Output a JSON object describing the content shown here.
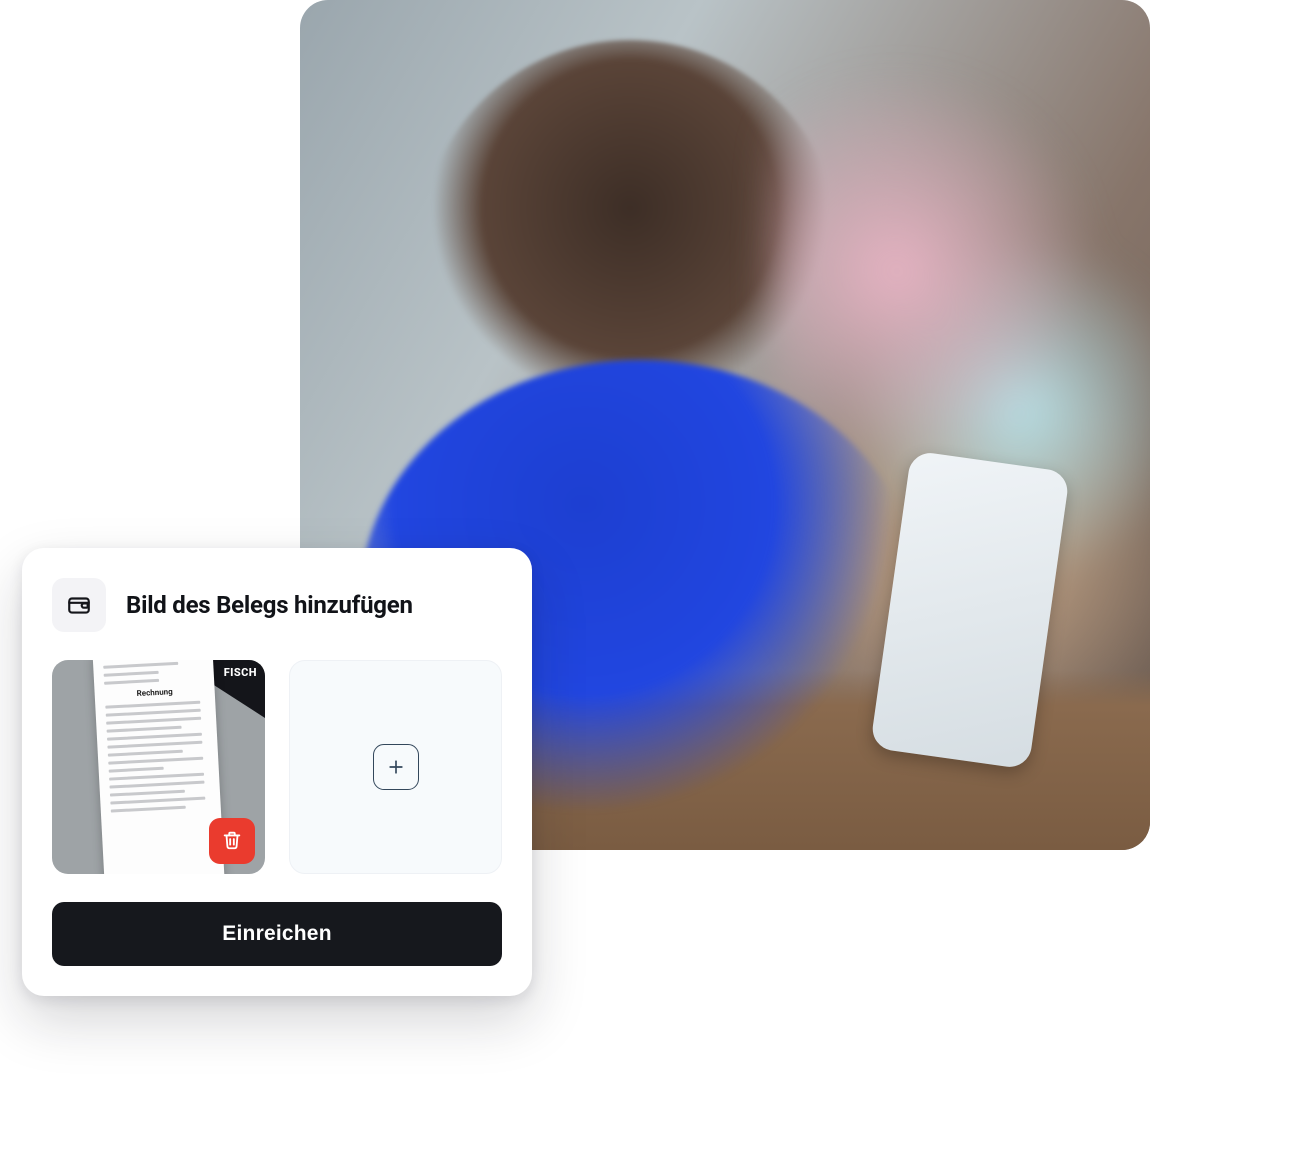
{
  "card": {
    "title": "Bild des Belegs hinzufügen",
    "submit_label": "Einreichen",
    "receipt_preview": {
      "heading": "Rechnung",
      "corner_text": "FISCH"
    }
  },
  "icons": {
    "header": "wallet-icon",
    "delete": "trash-icon",
    "add": "plus-icon"
  },
  "colors": {
    "accent_delete": "#ea3b2e",
    "submit_bg": "#16181d"
  }
}
